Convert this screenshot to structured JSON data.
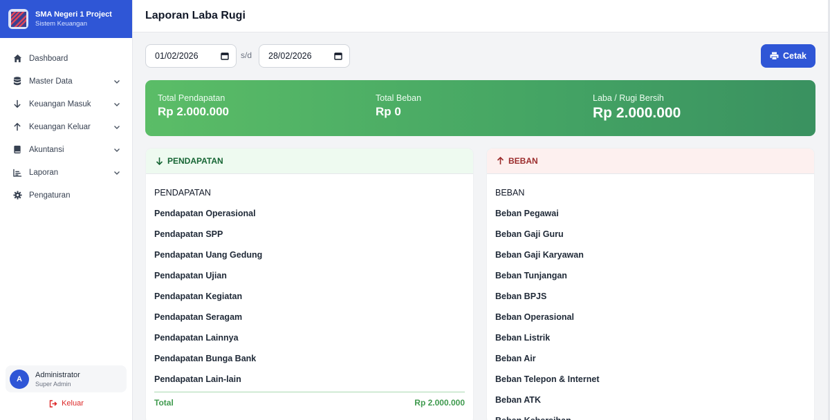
{
  "brand": {
    "title": "SMA Negeri 1 Project",
    "subtitle": "Sistem Keuangan"
  },
  "sidebar": {
    "items": [
      {
        "label": "Dashboard",
        "icon": "home-icon",
        "has_submenu": false
      },
      {
        "label": "Master Data",
        "icon": "database-icon",
        "has_submenu": true
      },
      {
        "label": "Keuangan Masuk",
        "icon": "arrow-down-icon",
        "has_submenu": true
      },
      {
        "label": "Keuangan Keluar",
        "icon": "arrow-up-icon",
        "has_submenu": true
      },
      {
        "label": "Akuntansi",
        "icon": "book-icon",
        "has_submenu": true
      },
      {
        "label": "Laporan",
        "icon": "chart-icon",
        "has_submenu": true
      },
      {
        "label": "Pengaturan",
        "icon": "gear-icon",
        "has_submenu": false
      }
    ]
  },
  "user": {
    "initial": "A",
    "name": "Administrator",
    "role": "Super Admin"
  },
  "logout_label": "Keluar",
  "header": {
    "title": "Laporan Laba Rugi"
  },
  "filters": {
    "start_date": "01/02/2026",
    "separator": "s/d",
    "end_date": "28/02/2026",
    "print_label": "Cetak"
  },
  "summary": {
    "income_label": "Total Pendapatan",
    "income_value": "Rp 2.000.000",
    "expense_label": "Total Beban",
    "expense_value": "Rp 0",
    "net_label": "Laba / Rugi Bersih",
    "net_value": "Rp 2.000.000"
  },
  "income": {
    "title": "PENDAPATAN",
    "group": "PENDAPATAN",
    "accounts": [
      "Pendapatan Operasional",
      "Pendapatan SPP",
      "Pendapatan Uang Gedung",
      "Pendapatan Ujian",
      "Pendapatan Kegiatan",
      "Pendapatan Seragam",
      "Pendapatan Lainnya",
      "Pendapatan Bunga Bank",
      "Pendapatan Lain-lain"
    ],
    "total_label": "Total",
    "total_value": "Rp 2.000.000"
  },
  "expense": {
    "title": "BEBAN",
    "group": "BEBAN",
    "accounts": [
      "Beban Pegawai",
      "Beban Gaji Guru",
      "Beban Gaji Karyawan",
      "Beban Tunjangan",
      "Beban BPJS",
      "Beban Operasional",
      "Beban Listrik",
      "Beban Air",
      "Beban Telepon & Internet",
      "Beban ATK",
      "Beban Kebersihan"
    ]
  },
  "colors": {
    "primary": "#2f56d6",
    "success": "#44a464",
    "danger": "#dc2626"
  }
}
